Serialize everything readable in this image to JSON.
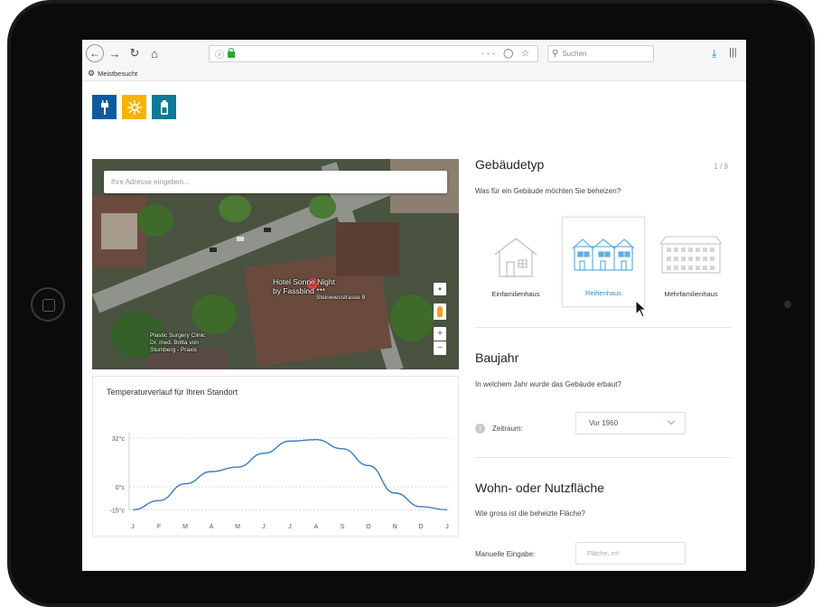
{
  "browser": {
    "search_placeholder": "Suchen",
    "url_info": "ⓘ",
    "url_actions": "··· ◯ ☆",
    "bookmark_label": "Meistbesucht"
  },
  "tiles": [
    {
      "icon": "plug-icon",
      "color": "#0e5aa0"
    },
    {
      "icon": "sun-icon",
      "color": "#f5b400"
    },
    {
      "icon": "battery-icon",
      "color": "#0d7a96"
    }
  ],
  "map": {
    "address_placeholder": "Ihre Adresse eingeben...",
    "hotel_label_1": "Hotel Sonne Night",
    "hotel_label_2": "by Fassbind ***",
    "street_label": "Steinwiesstrasse 8",
    "poi_label_1": "Plastic Surgery Clinic",
    "poi_label_2": "Dr. med. Britta von",
    "poi_label_3": "Stumberg - Praxis",
    "zoom_in": "+",
    "zoom_out": "−"
  },
  "temperature": {
    "title": "Temperaturverlauf für Ihren Standort",
    "y_ticks": [
      "32°c",
      "0°c",
      "-15°c"
    ],
    "months": [
      "J",
      "F",
      "M",
      "A",
      "M",
      "J",
      "J",
      "A",
      "S",
      "O",
      "N",
      "D",
      "J"
    ]
  },
  "chart_data": {
    "type": "line",
    "title": "Temperaturverlauf für Ihren Standort",
    "xlabel": "",
    "ylabel": "",
    "categories": [
      "J",
      "F",
      "M",
      "A",
      "M",
      "J",
      "J",
      "A",
      "S",
      "O",
      "N",
      "D",
      "J"
    ],
    "y_ticks": [
      32,
      0,
      -15
    ],
    "series": [
      {
        "values": [
          -15,
          -9,
          2,
          10,
          13,
          22,
          30,
          31,
          25,
          14,
          -4,
          -13,
          -15
        ]
      }
    ],
    "color": "#3a7cbf",
    "grid": "dashed horizontal",
    "legend": "none"
  },
  "panel": {
    "building_type": {
      "title": "Gebäudetyp",
      "step": "1 / 9",
      "question": "Was für ein Gebäude möchten Sie beheizen?",
      "options": [
        {
          "label": "Einfamilienhaus",
          "icon": "single-family-house-icon",
          "selected": false
        },
        {
          "label": "Reihenhaus",
          "icon": "row-house-icon",
          "selected": true
        },
        {
          "label": "Mehrfamilienhaus",
          "icon": "apartment-building-icon",
          "selected": false
        }
      ]
    },
    "year": {
      "title": "Baujahr",
      "question": "In welchem Jahr wurde das Gebäude erbaut?",
      "field_label": "Zeitraum:",
      "value": "Vor 1960"
    },
    "area": {
      "title": "Wohn- oder Nutzfläche",
      "question": "Wie gross ist die beheizte Fläche?",
      "field_label": "Manuelle Eingabe:",
      "placeholder": "Fläche, m²"
    }
  },
  "colors": {
    "accent": "#2f8fc9",
    "line": "#3a7cbf",
    "selected_icon": "#62aee0"
  }
}
